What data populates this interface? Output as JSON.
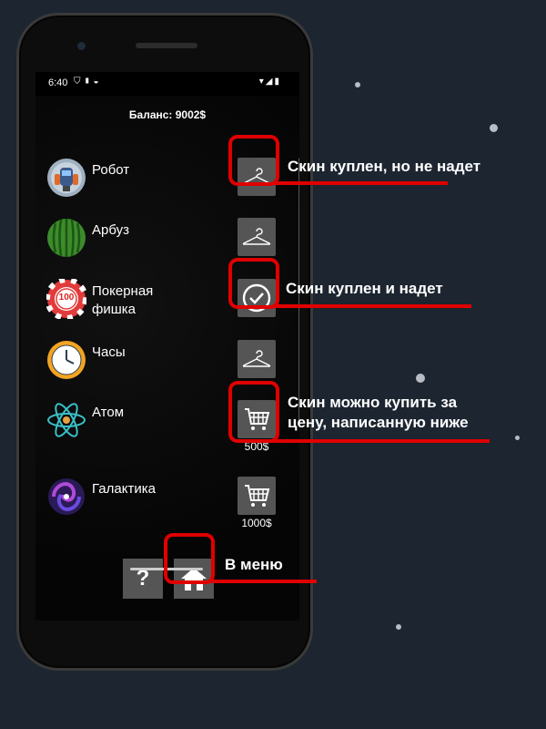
{
  "status": {
    "time": "6:40"
  },
  "balance": "Баланс: 9002$",
  "skins": [
    {
      "name": "Робот",
      "icon": "robot-icon",
      "state": "purchased-not-equipped",
      "price": ""
    },
    {
      "name": "Арбуз",
      "icon": "watermelon-icon",
      "state": "purchased-not-equipped",
      "price": ""
    },
    {
      "name": "Покерная фишка",
      "icon": "poker-chip-icon",
      "chip_label": "100",
      "state": "equipped",
      "price": ""
    },
    {
      "name": "Часы",
      "icon": "clock-icon",
      "state": "purchased-not-equipped",
      "price": ""
    },
    {
      "name": "Атом",
      "icon": "atom-icon",
      "state": "for-sale",
      "price": "500$"
    },
    {
      "name": "Галактика",
      "icon": "galaxy-icon",
      "state": "for-sale",
      "price": "1000$"
    }
  ],
  "buttons": {
    "help_label": "?",
    "home_icon": "home-icon"
  },
  "annotations": {
    "bought_not_equipped": "Скин куплен, но не надет",
    "bought_equipped": "Скин куплен и надет",
    "can_buy_line1": "Скин можно купить за",
    "can_buy_line2": "цену, написанную ниже",
    "to_menu": "В меню"
  },
  "colors": {
    "highlight": "#e00000",
    "background": "#1c2530",
    "button": "#555555"
  }
}
